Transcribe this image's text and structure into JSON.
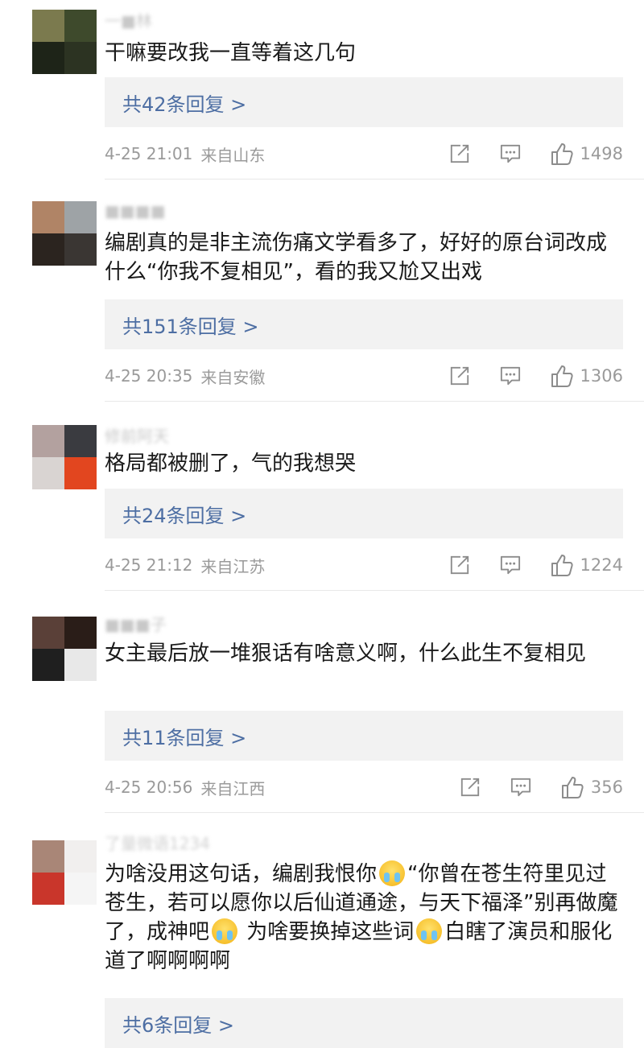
{
  "comments": [
    {
      "username": "一■林",
      "text_segments": [
        "干嘛要改我一直等着这几句"
      ],
      "replies_label": "共42条回复 >",
      "time": "4-25 21:01",
      "location": "来自山东",
      "likes": "1498",
      "avatar_colors": [
        "#7b7a4e",
        "#3e4a2c",
        "#1e2418",
        "#2c3322"
      ]
    },
    {
      "username": "■■■■",
      "text_segments": [
        "编剧真的是非主流伤痛文学看多了，好好的原台词改成什么“你我不复相见”，看的我又尬又出戏"
      ],
      "replies_label": "共151条回复 >",
      "time": "4-25 20:35",
      "location": "来自安徽",
      "likes": "1306",
      "avatar_colors": [
        "#b08466",
        "#9ea3a6",
        "#2b241f",
        "#3a3633"
      ]
    },
    {
      "username": "修前阿天",
      "text_segments": [
        "格局都被删了，气的我想哭"
      ],
      "replies_label": "共24条回复 >",
      "time": "4-25 21:12",
      "location": "来自江苏",
      "likes": "1224",
      "avatar_colors": [
        "#b3a19f",
        "#3a3b40",
        "#d9d4d2",
        "#e2461f"
      ]
    },
    {
      "username": "■■■子",
      "text_segments": [
        "女主最后放一堆狠话有啥意义啊，什么此生不复相见"
      ],
      "replies_label": "共11条回复 >",
      "time": "4-25 20:56",
      "location": "来自江西",
      "likes": "356",
      "avatar_colors": [
        "#5a4038",
        "#2a1d18",
        "#1f1f1f",
        "#e8e8e8"
      ]
    },
    {
      "username": "了量微语1234",
      "text_segments": [
        "为啥没用这句话，编剧我恨你",
        "“你曾在苍生符里见过苍生，若可以愿你以后仙道通途，与天下福泽”别再做魔了，成神吧",
        " 为啥要换掉这些词",
        "白瞎了演员和服化道了啊啊啊啊"
      ],
      "replies_label": "共6条回复 >",
      "avatar_colors": [
        "#a98677",
        "#f1efee",
        "#c9362b",
        "#f5f5f5"
      ]
    }
  ],
  "icons": {
    "share": "share-icon",
    "comment": "comment-icon",
    "like": "thumbs-up-icon",
    "emoji": "crying-face-emoji-icon"
  },
  "colors": {
    "link": "#4d6ea3",
    "meta": "#9a9a9a",
    "reply_bg": "#f2f2f2"
  }
}
